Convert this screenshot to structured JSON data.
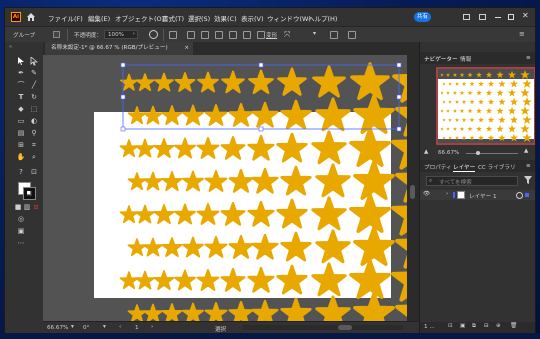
{
  "menubar": {
    "menus": [
      "ファイル(F)",
      "編集(E)",
      "オブジェクト(O)",
      "書式(T)",
      "選択(S)",
      "効果(C)",
      "表示(V)",
      "ウィンドウ(W)",
      "ヘルプ(H)"
    ],
    "share_label": "共有"
  },
  "control_bar": {
    "selection_label": "グループ",
    "opacity_label": "不透明度：",
    "opacity_value": "100%",
    "transform_label": "変形"
  },
  "document": {
    "tab_label": "名称未設定-1* @ 66.67 % (RGB/プレビュー)",
    "close_glyph": "×"
  },
  "artwork": {
    "star_color": "#e8a800",
    "artboard_color": "#ffffff"
  },
  "statusbar": {
    "zoom": "66.67%",
    "rotation": "0°",
    "artboard_number": "1",
    "tool_label": "選択"
  },
  "navigator": {
    "tabs": [
      "ナビゲーター",
      "情報"
    ],
    "zoom": "66.67%"
  },
  "layers_panel": {
    "tabs": [
      "プロパティ",
      "レイヤー",
      "CC ライブラリ"
    ],
    "search_placeholder": "すべてを検索",
    "layer_name": "レイヤー 1",
    "footer_count": "1 ..."
  }
}
